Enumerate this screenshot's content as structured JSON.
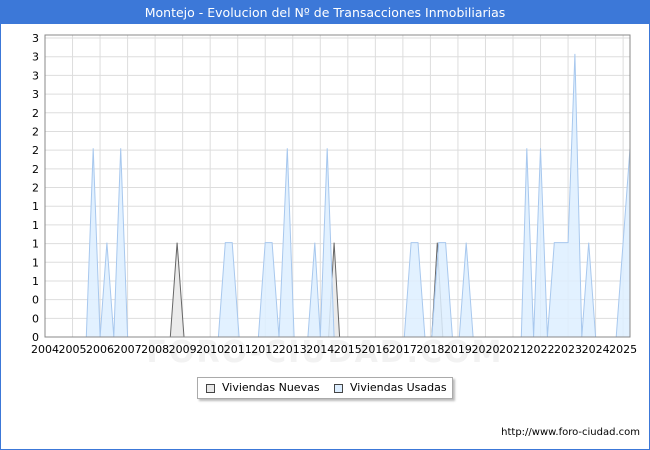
{
  "header": {
    "title": "Montejo - Evolucion del Nº de Transacciones Inmobiliarias"
  },
  "footer": {
    "url": "http://www.foro-ciudad.com"
  },
  "watermark": {
    "text": "FORO-CIUDAD.COM"
  },
  "legend": {
    "items": [
      {
        "label": "Viviendas Nuevas",
        "color": "#e8e8e8"
      },
      {
        "label": "Viviendas Usadas",
        "color": "#ddeeff"
      }
    ]
  },
  "chart_data": {
    "type": "area",
    "title": "Montejo - Evolucion del Nº de Transacciones Inmobiliarias",
    "xlabel": "",
    "ylabel": "",
    "xlim": [
      2004,
      2025.25
    ],
    "ylim": [
      0,
      3.2
    ],
    "y_tick_labels": [
      "0",
      "0",
      "0",
      "1",
      "1",
      "1",
      "1",
      "1",
      "2",
      "2",
      "2",
      "2",
      "2",
      "3",
      "3",
      "3",
      "3"
    ],
    "x_tick_labels": [
      "2004",
      "2005",
      "2006",
      "2007",
      "2008",
      "2009",
      "2010",
      "2011",
      "2012",
      "2013",
      "2014",
      "2015",
      "2016",
      "2017",
      "2018",
      "2019",
      "2020",
      "2021",
      "2022",
      "2023",
      "2024",
      "2025"
    ],
    "grid": true,
    "legend_position": "bottom",
    "series": [
      {
        "name": "Viviendas Nuevas",
        "color": "#e8e8e8",
        "stroke": "#666666",
        "x": [
          2008.55,
          2008.8,
          2009.05,
          2014.3,
          2014.5,
          2014.7,
          2018.05,
          2018.25,
          2018.45
        ],
        "y": [
          0,
          1,
          0,
          0,
          1,
          0,
          0,
          1,
          0
        ]
      },
      {
        "name": "Viviendas Usadas",
        "color": "#ddeeff",
        "stroke": "#a8c8ee",
        "x": [
          2005.5,
          2005.75,
          2006.0,
          2006.25,
          2006.5,
          2006.75,
          2007.0,
          2007.25,
          2010.3,
          2010.55,
          2010.8,
          2011.05,
          2011.75,
          2012.0,
          2012.25,
          2012.5,
          2012.8,
          2013.05,
          2013.3,
          2013.55,
          2013.8,
          2014.0,
          2014.25,
          2014.5,
          2014.75,
          2017.05,
          2017.3,
          2017.55,
          2017.8,
          2018.05,
          2018.3,
          2018.55,
          2018.8,
          2019.05,
          2019.3,
          2019.55,
          2019.8,
          2021.3,
          2021.5,
          2021.75,
          2022.0,
          2022.25,
          2022.5,
          2022.75,
          2023.0,
          2023.25,
          2023.5,
          2023.75,
          2024.0,
          2024.25,
          2024.5,
          2024.75,
          2025.0,
          2025.25
        ],
        "y": [
          0,
          2,
          0,
          1,
          0,
          2,
          0,
          0,
          0,
          1,
          1,
          0,
          0,
          1,
          1,
          0,
          2,
          0,
          0,
          0,
          1,
          0,
          2,
          0,
          0,
          0,
          1,
          1,
          0,
          0,
          1,
          1,
          0,
          0,
          1,
          0,
          0,
          0,
          2,
          0,
          2,
          0,
          1,
          1,
          1,
          3,
          0,
          1,
          0,
          0,
          0,
          0,
          1,
          2
        ]
      }
    ]
  }
}
